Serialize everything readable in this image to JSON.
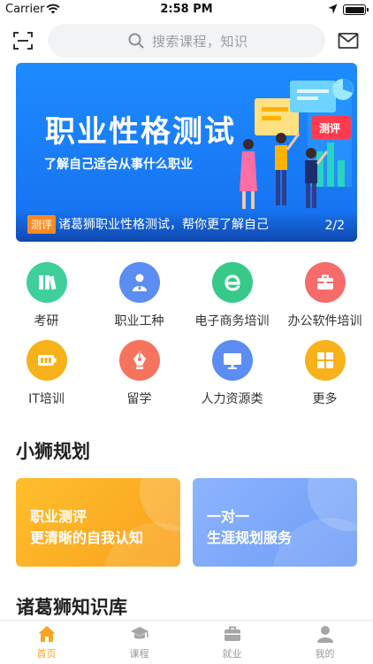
{
  "status_bar": {
    "carrier": "Carrier",
    "time": "2:58 PM"
  },
  "search": {
    "placeholder": "搜索课程，知识"
  },
  "banner": {
    "title": "职业性格测试",
    "subtitle": "了解自己适合从事什么职业",
    "art_tag": "测评",
    "caption_tag": "测评",
    "caption": "诸葛狮职业性格测试，帮你更了解自己",
    "pager": "2/2"
  },
  "categories": [
    {
      "label": "考研",
      "icon": "books-icon",
      "color": "#3ecf9b"
    },
    {
      "label": "职业工种",
      "icon": "worker-icon",
      "color": "#5b8df2"
    },
    {
      "label": "电子商务培训",
      "icon": "ecommerce-e-icon",
      "color": "#36c98a"
    },
    {
      "label": "办公软件培训",
      "icon": "briefcase-icon",
      "color": "#f76b6b"
    },
    {
      "label": "IT培训",
      "icon": "battery-icon",
      "color": "#f7b21b"
    },
    {
      "label": "留学",
      "icon": "pen-nib-icon",
      "color": "#f7735e"
    },
    {
      "label": "人力资源类",
      "icon": "monitor-icon",
      "color": "#5b8df2"
    },
    {
      "label": "更多",
      "icon": "grid-icon",
      "color": "#f7b21b"
    }
  ],
  "sections": {
    "planning_title": "小狮规划",
    "knowledge_title": "诸葛狮知识库"
  },
  "cards": [
    {
      "line1": "职业测评",
      "line2": "更清晰的自我认知",
      "color_from": "#ffbe2e",
      "color_to": "#f9a11b"
    },
    {
      "line1": "一对一",
      "line2": "生涯规划服务",
      "color_from": "#8db4ff",
      "color_to": "#6e9cf5"
    }
  ],
  "tabs": [
    {
      "label": "首页",
      "icon": "home-icon",
      "active": true
    },
    {
      "label": "课程",
      "icon": "graduation-cap-icon",
      "active": false
    },
    {
      "label": "就业",
      "icon": "briefcase-icon",
      "active": false
    },
    {
      "label": "我的",
      "icon": "person-icon",
      "active": false
    }
  ],
  "colors": {
    "accent": "#f5a623",
    "tab_inactive": "#9a9a9a",
    "banner_blue": "#1670f0"
  }
}
